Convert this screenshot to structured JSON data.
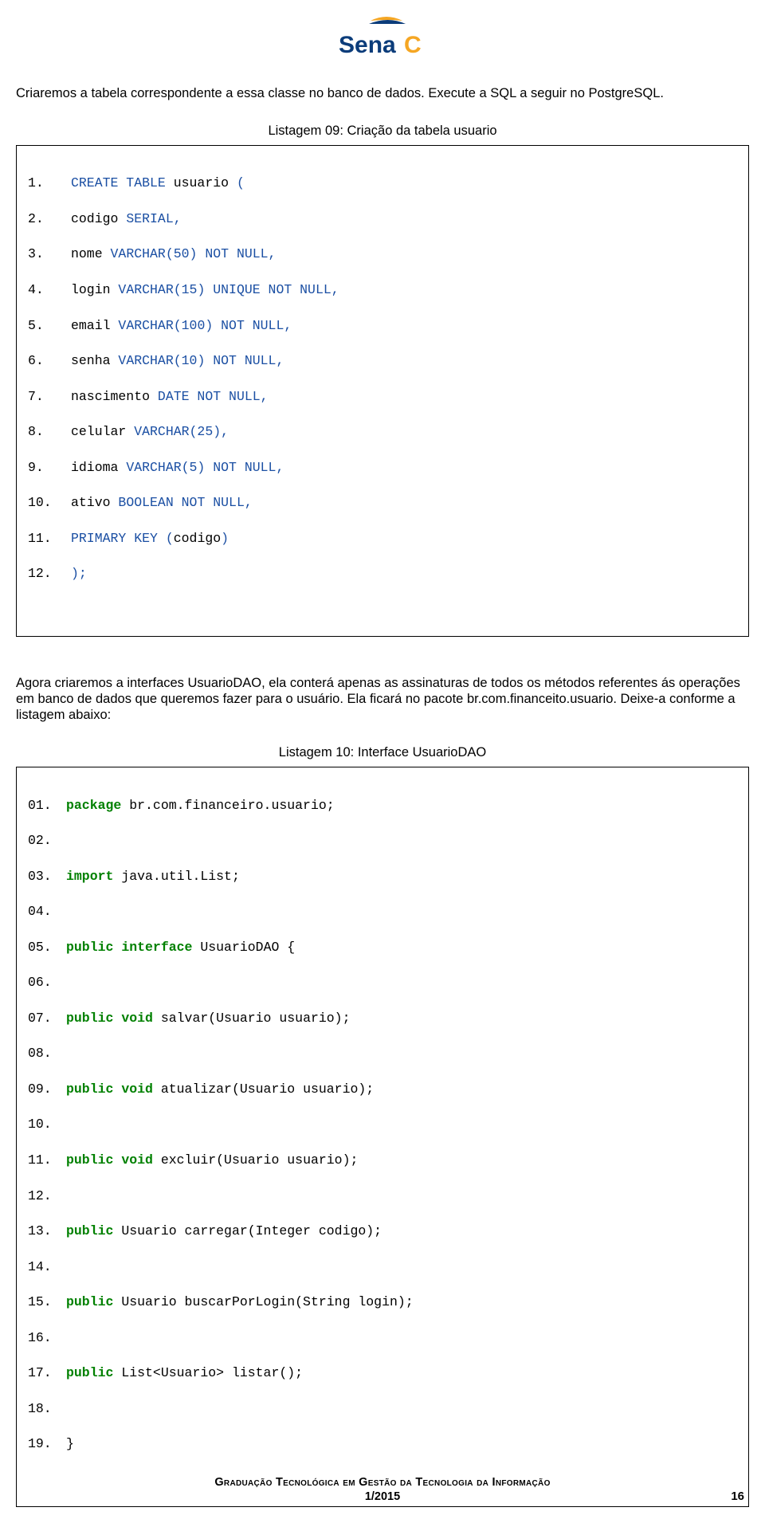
{
  "logo_text": "Senac",
  "intro": "Criaremos a tabela correspondente a essa classe no banco de dados. Execute a SQL a seguir no PostgreSQL.",
  "caption9": "Listagem 09: Criação da tabela usuario",
  "code9": {
    "l1_num": "1.",
    "l1_a": "CREATE TABLE",
    "l1_b": " usuario ",
    "l1_c": "(",
    "l2_num": "2.",
    "l2_a": "codigo ",
    "l2_b": "SERIAL,",
    "l3_num": "3.",
    "l3_a": "nome ",
    "l3_b": "VARCHAR(50) NOT NULL,",
    "l4_num": "4.",
    "l4_a": "login ",
    "l4_b": "VARCHAR(15) UNIQUE NOT NULL,",
    "l5_num": "5.",
    "l5_a": "email ",
    "l5_b": "VARCHAR(100) NOT NULL,",
    "l6_num": "6.",
    "l6_a": "senha ",
    "l6_b": "VARCHAR(10) NOT NULL,",
    "l7_num": "7.",
    "l7_a": "nascimento ",
    "l7_b": "DATE NOT NULL,",
    "l8_num": "8.",
    "l8_a": "celular ",
    "l8_b": "VARCHAR(25),",
    "l9_num": "9.",
    "l9_a": "idioma ",
    "l9_b": "VARCHAR(5) NOT NULL,",
    "l10_num": "10.",
    "l10_a": "ativo ",
    "l10_b": "BOOLEAN NOT NULL,",
    "l11_num": "11.",
    "l11_a": "PRIMARY KEY ",
    "l11_b": "(",
    "l11_c": "codigo",
    "l11_d": ")",
    "l12_num": "12.",
    "l12_a": ");"
  },
  "middle": "Agora criaremos a interfaces UsuarioDAO, ela conterá apenas as assinaturas de todos os métodos referentes ás operações em banco de dados que queremos fazer para o usuário. Ela ficará no pacote br.com.financeito.usuario. Deixe-a conforme a listagem abaixo:",
  "caption10": "Listagem 10: Interface UsuarioDAO",
  "code10": {
    "l01_num": "01.",
    "l01_a": "package",
    "l01_b": " br.com.financeiro.usuario;",
    "l02_num": "02.",
    "l03_num": "03.",
    "l03_a": "import",
    "l03_b": " java.util.List;",
    "l04_num": "04.",
    "l05_num": "05.",
    "l05_a": "public",
    "l05_b": " ",
    "l05_c": "interface",
    "l05_d": " UsuarioDAO {",
    "l06_num": "06.",
    "l07_num": "07.",
    "l07_a": "public",
    "l07_b": " ",
    "l07_c": "void",
    "l07_d": " salvar(Usuario usuario);",
    "l08_num": "08.",
    "l09_num": "09.",
    "l09_a": "public",
    "l09_b": " ",
    "l09_c": "void",
    "l09_d": " atualizar(Usuario usuario);",
    "l10_num": "10.",
    "l11_num": "11.",
    "l11_a": "public",
    "l11_b": " ",
    "l11_c": "void",
    "l11_d": " excluir(Usuario usuario);",
    "l12_num": "12.",
    "l13_num": "13.",
    "l13_a": "public",
    "l13_b": " Usuario carregar(Integer codigo);",
    "l14_num": "14.",
    "l15_num": "15.",
    "l15_a": "public",
    "l15_b": " Usuario buscarPorLogin(String login);",
    "l16_num": "16.",
    "l17_num": "17.",
    "l17_a": "public",
    "l17_b": " List<Usuario> listar();",
    "l18_num": "18.",
    "l19_num": "19.",
    "l19_a": "}"
  },
  "footer_line1": "Graduação Tecnológica em Gestão da Tecnologia da Informação",
  "footer_date": "1/2015",
  "page_number": "16"
}
